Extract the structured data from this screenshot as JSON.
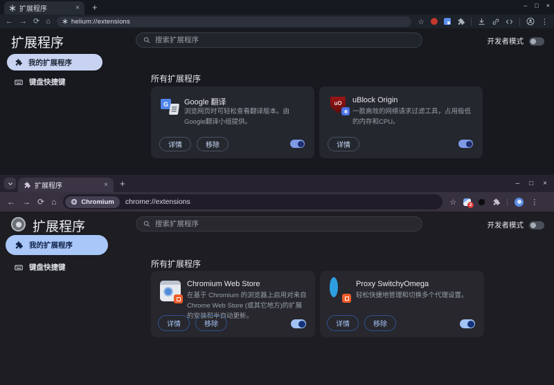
{
  "glyphs": {
    "back": "←",
    "forward": "→",
    "reload": "⟳",
    "home": "⌂",
    "star": "☆",
    "menu": "⋮",
    "plus": "+",
    "close_tab": "×",
    "minimize": "–",
    "maximize": "□",
    "close_window": "×",
    "gt_letter": "G",
    "ublock_letters": "uO"
  },
  "top_window": {
    "tab_title": "扩展程序",
    "url": "helium://extensions",
    "page": {
      "title": "扩展程序",
      "search_placeholder": "搜索扩展程序",
      "developer_mode_label": "开发者模式",
      "sidebar": {
        "my_extensions": "我的扩展程序",
        "keyboard_shortcuts": "键盘快捷键"
      },
      "section_title": "所有扩展程序",
      "buttons": {
        "details": "详情",
        "remove": "移除"
      },
      "cards": [
        {
          "name": "Google 翻译",
          "description": "浏览网页时可轻松查看翻译版本。由Google翻译小组提供。",
          "toggle": "on"
        },
        {
          "name": "uBlock Origin",
          "description": "一款高效的网络请求过滤工具，占用极低的内存和CPU。",
          "toggle": "on"
        }
      ]
    }
  },
  "bottom_window": {
    "tab_title": "扩展程序",
    "address_chip": "Chromium",
    "url": "chrome://extensions",
    "extension_badge_count": "2",
    "page": {
      "title": "扩展程序",
      "search_placeholder": "搜索扩展程序",
      "developer_mode_label": "开发者模式",
      "sidebar": {
        "my_extensions": "我的扩展程序",
        "keyboard_shortcuts": "键盘快捷键"
      },
      "section_title": "所有扩展程序",
      "buttons": {
        "details": "详情",
        "remove": "移除"
      },
      "cards": [
        {
          "name": "Chromium Web Store",
          "description": "在基于 Chromium 的浏览器上启用对来自 Chrome Web Store (或其它地方)的扩展的安装和半自动更新。",
          "toggle": "on"
        },
        {
          "name": "Proxy SwitchyOmega",
          "description": "轻松快捷地管理和切换多个代理设置。",
          "toggle": "on"
        }
      ]
    }
  },
  "colors": {
    "accent_blue": "#8ab4f8",
    "selected_pill_top": "#c7d3f1",
    "selected_pill_bottom": "#a9c7f8",
    "toggle_on_top": "#7e9ae4",
    "toggle_on_bottom": "#a3c3f5",
    "ublock_red": "#8c1313",
    "badge_red": "#e23b3b",
    "switchy_blue": "#2d9fe0",
    "badge_orange": "#ee5c2a"
  }
}
